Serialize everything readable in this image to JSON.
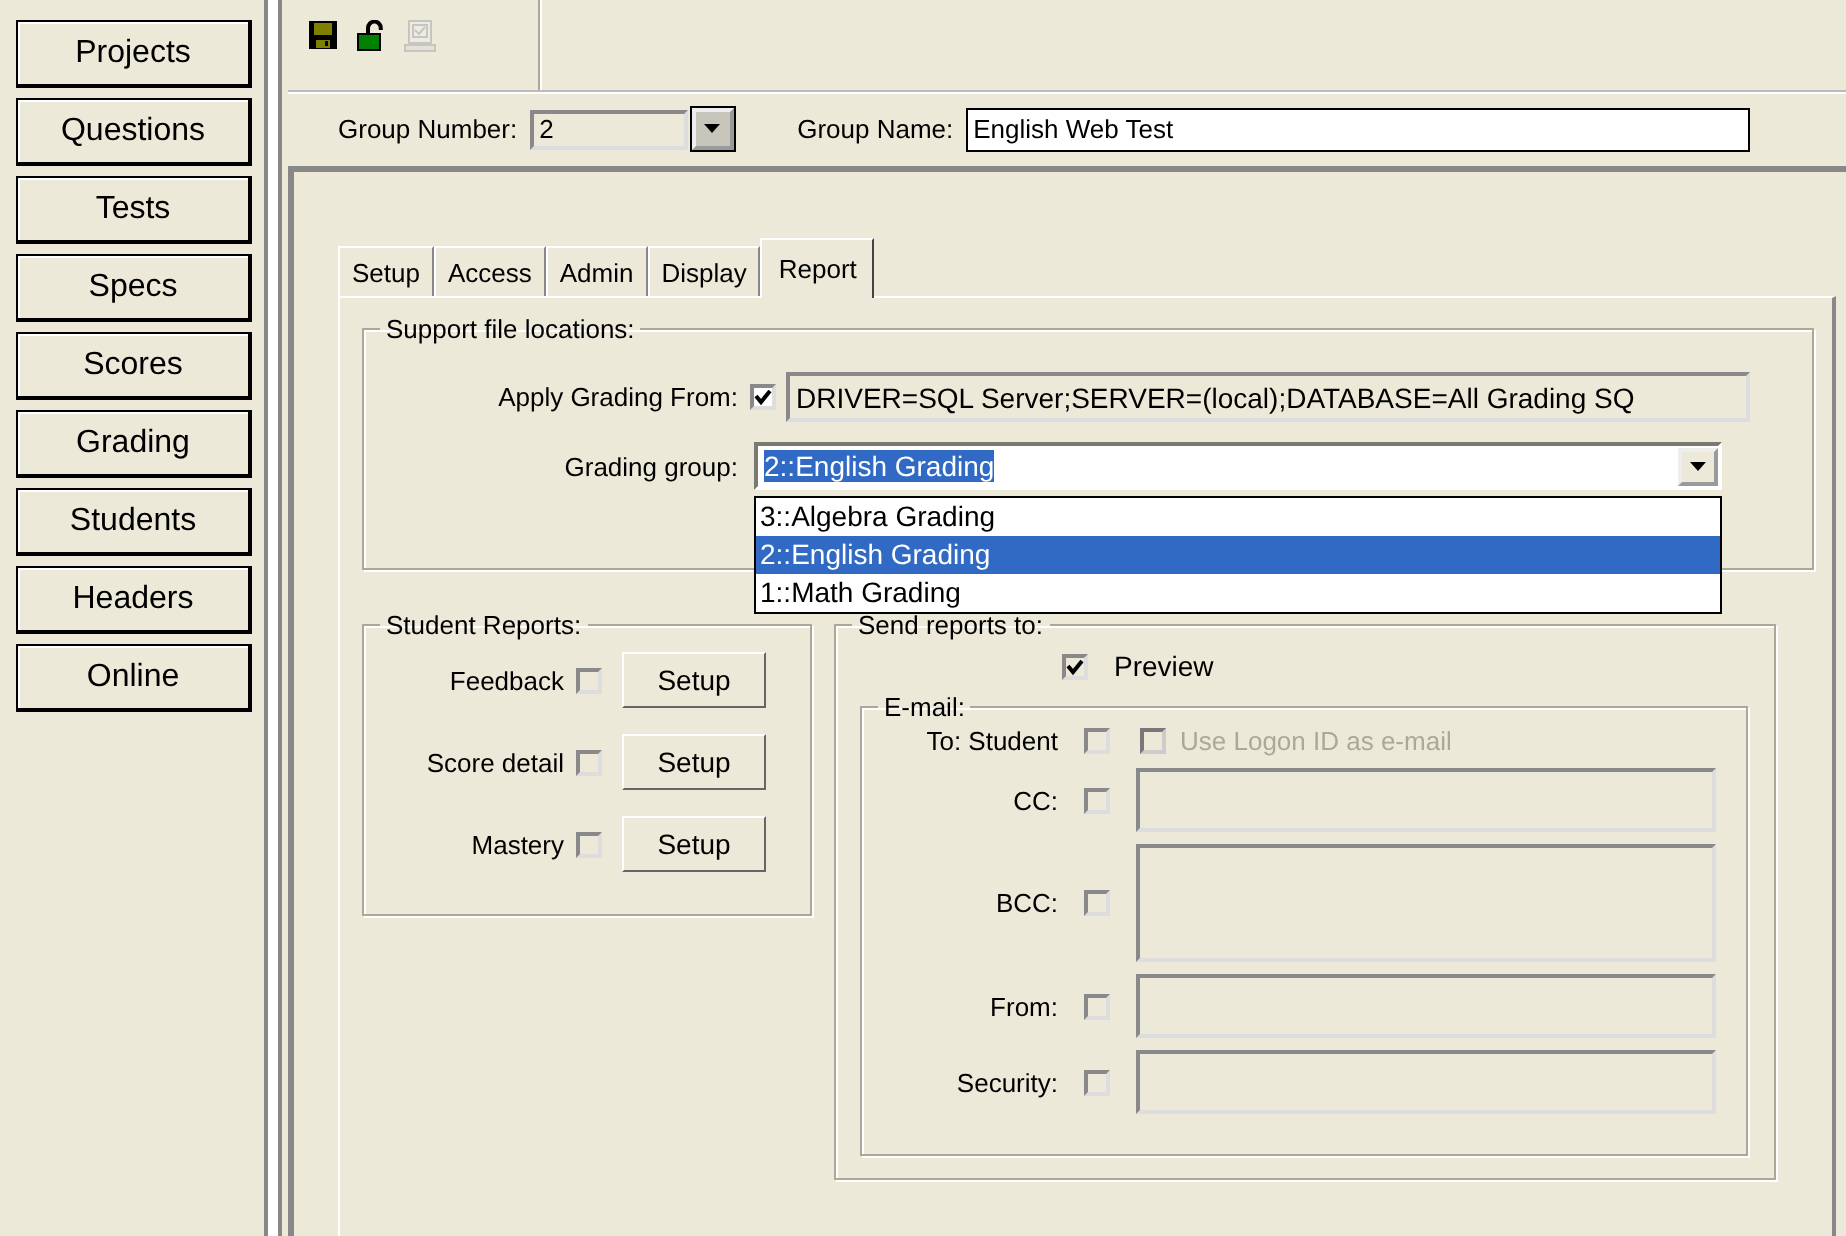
{
  "sidebar": {
    "items": [
      {
        "label": "Projects"
      },
      {
        "label": "Questions"
      },
      {
        "label": "Tests"
      },
      {
        "label": "Specs"
      },
      {
        "label": "Scores"
      },
      {
        "label": "Grading"
      },
      {
        "label": "Students"
      },
      {
        "label": "Headers"
      },
      {
        "label": "Online"
      }
    ]
  },
  "toolbar": {
    "buttons": [
      {
        "kind": "save",
        "disabled": false
      },
      {
        "kind": "unlock",
        "disabled": false
      },
      {
        "kind": "computer",
        "disabled": true
      }
    ]
  },
  "group_number": {
    "label": "Group Number:",
    "value": "2"
  },
  "group_name": {
    "label": "Group Name:",
    "value": "English Web Test"
  },
  "tabs": [
    {
      "label": "Setup",
      "selected": false
    },
    {
      "label": "Access",
      "selected": false
    },
    {
      "label": "Admin",
      "selected": false
    },
    {
      "label": "Display",
      "selected": false
    },
    {
      "label": "Report",
      "selected": true
    }
  ],
  "support_files": {
    "title": "Support file locations:",
    "apply_grading": {
      "label": "Apply Grading From:",
      "checked": true,
      "value": "DRIVER=SQL Server;SERVER=(local);DATABASE=All Grading SQ"
    },
    "grading_group": {
      "label": "Grading group:",
      "value": "2::English Grading",
      "expanded": true,
      "options": [
        {
          "label": "3::Algebra Grading",
          "selected": false
        },
        {
          "label": "2::English Grading",
          "selected": true
        },
        {
          "label": "1::Math Grading",
          "selected": false
        }
      ]
    }
  },
  "student_reports": {
    "title": "Student Reports:",
    "items": [
      {
        "label": "Feedback",
        "checked": false,
        "button": "Setup"
      },
      {
        "label": "Score detail",
        "checked": false,
        "button": "Setup"
      },
      {
        "label": "Mastery",
        "checked": false,
        "button": "Setup"
      }
    ]
  },
  "send_reports": {
    "title": "Send reports to:",
    "preview": {
      "label": "Preview",
      "checked": true
    },
    "email": {
      "title": "E-mail:",
      "to_student": {
        "label": "To: Student",
        "checked": false
      },
      "use_logon": {
        "label": "Use Logon ID as e-mail",
        "checked": false,
        "disabled": true
      },
      "fields": [
        {
          "label": "CC:",
          "checked": false,
          "kind": "line",
          "disabled": true
        },
        {
          "label": "BCC:",
          "checked": false,
          "kind": "area",
          "disabled": true
        },
        {
          "label": "From:",
          "checked": false,
          "kind": "line",
          "disabled": true
        },
        {
          "label": "Security:",
          "checked": false,
          "kind": "line",
          "disabled": true
        }
      ]
    }
  }
}
